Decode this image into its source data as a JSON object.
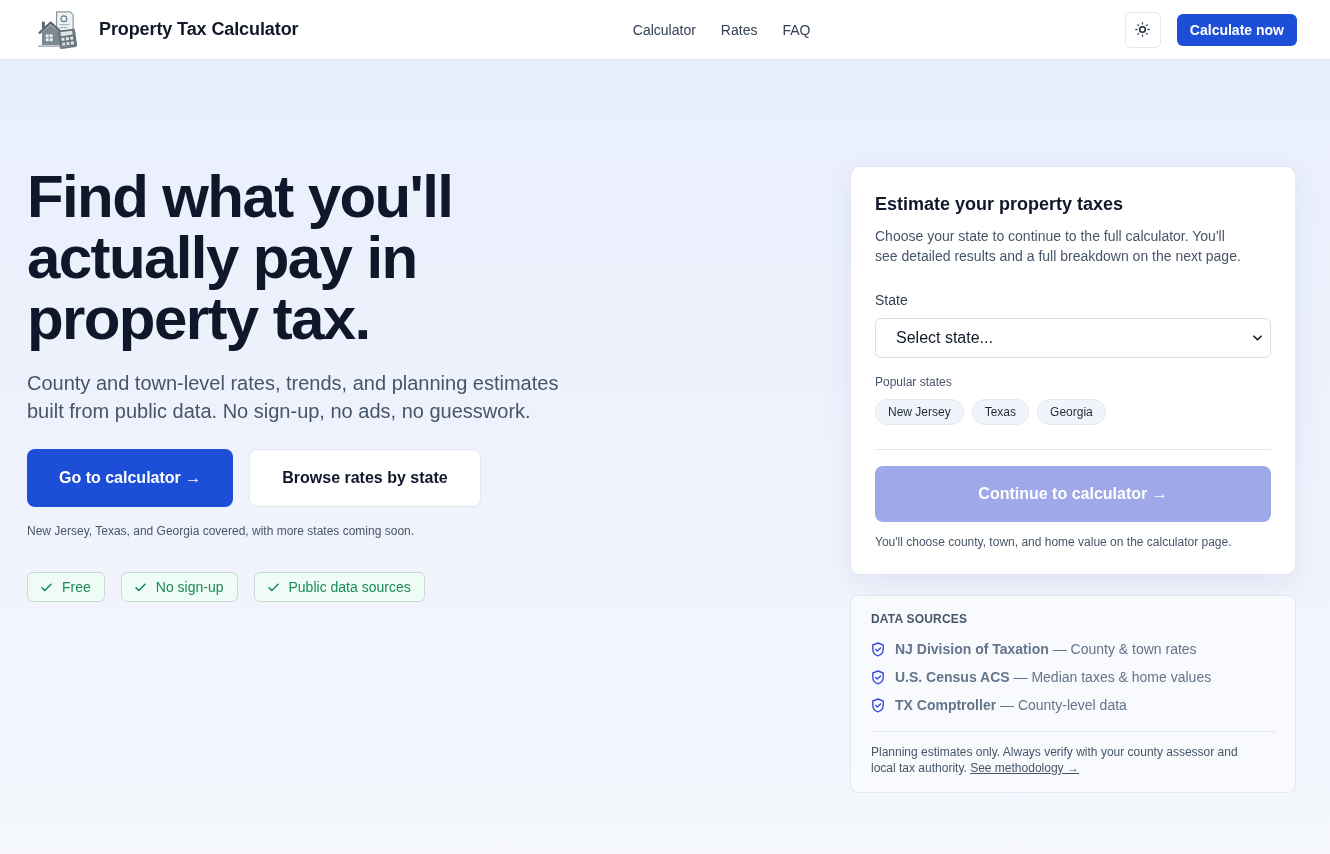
{
  "header": {
    "title": "Property Tax Calculator",
    "nav": [
      "Calculator",
      "Rates",
      "FAQ"
    ],
    "cta": "Calculate now"
  },
  "hero": {
    "heading": "Find what you'll actually pay in property tax.",
    "subtitle": "County and town-level rates, trends, and planning estimates built from public data. No sign-up, no ads, no guesswork.",
    "buttons": [
      {
        "label": "Go to calculator →",
        "kind": "primary"
      },
      {
        "label": "Browse rates by state",
        "kind": "secondary"
      }
    ],
    "coverage_note": "New Jersey, Texas, and Georgia covered, with more states coming soon.",
    "features": [
      "Free",
      "No sign-up",
      "Public data sources"
    ]
  },
  "estimate_card": {
    "title": "Estimate your property taxes",
    "description": "Choose your state to continue to the full calculator. You'll see detailed results and a full breakdown on the next page.",
    "state_field": {
      "label": "State",
      "placeholder": "Select state..."
    },
    "popular_label": "Popular states",
    "popular_states": [
      "New Jersey",
      "Texas",
      "Georgia"
    ],
    "continue_button": {
      "label": "Continue to calculator →",
      "disabled": true
    },
    "note": "You'll choose county, town, and home value on the calculator page."
  },
  "data_sources": {
    "title": "DATA SOURCES",
    "items": [
      "**NJ Division of Taxation** — County & town rates",
      "**U.S. Census ACS** — Median taxes & home values",
      "**TX Comptroller** — County-level data"
    ],
    "disclaimer": "Planning estimates only. Always verify with your county assessor and local tax authority.",
    "link": "See methodology →"
  }
}
